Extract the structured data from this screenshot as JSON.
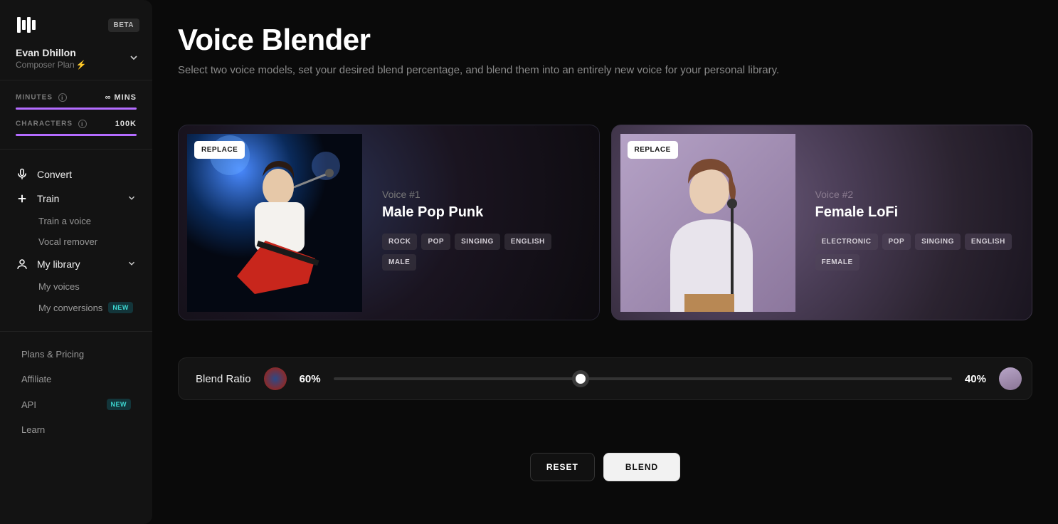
{
  "sidebar": {
    "beta_badge": "BETA",
    "user": {
      "name": "Evan Dhillon",
      "plan": "Composer Plan"
    },
    "usage": {
      "minutes_label": "MINUTES",
      "minutes_value": "∞ MINS",
      "characters_label": "CHARACTERS",
      "characters_value": "100K"
    },
    "nav": {
      "convert": "Convert",
      "train": "Train",
      "train_voice": "Train a voice",
      "vocal_remover": "Vocal remover",
      "my_library": "My library",
      "my_voices": "My voices",
      "my_conversions": "My conversions",
      "new_badge": "NEW"
    },
    "footer": {
      "plans": "Plans & Pricing",
      "affiliate": "Affiliate",
      "api": "API",
      "learn": "Learn"
    }
  },
  "page": {
    "title": "Voice Blender",
    "subtitle": "Select two voice models, set your desired blend percentage, and blend them into an entirely new voice for your personal library."
  },
  "voices": [
    {
      "replace_label": "REPLACE",
      "slot_label": "Voice #1",
      "name": "Male Pop Punk",
      "tags": [
        "ROCK",
        "POP",
        "SINGING",
        "ENGLISH",
        "MALE"
      ]
    },
    {
      "replace_label": "REPLACE",
      "slot_label": "Voice #2",
      "name": "Female LoFi",
      "tags": [
        "ELECTRONIC",
        "POP",
        "SINGING",
        "ENGLISH",
        "FEMALE"
      ]
    }
  ],
  "blend": {
    "label": "Blend Ratio",
    "left_pct": "60%",
    "right_pct": "40%",
    "thumb_position_pct": 40
  },
  "actions": {
    "reset": "RESET",
    "blend": "BLEND"
  }
}
